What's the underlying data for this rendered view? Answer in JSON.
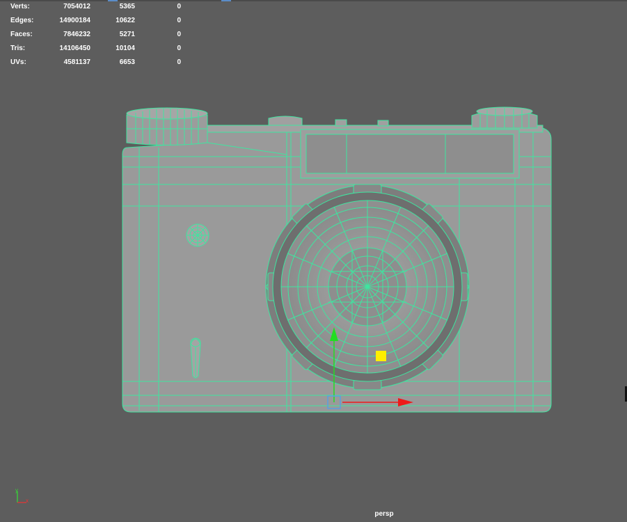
{
  "heads_up_display": {
    "rows": [
      {
        "label": "Verts:",
        "values": [
          "7054012",
          "5365",
          "0"
        ]
      },
      {
        "label": "Edges:",
        "values": [
          "14900184",
          "10622",
          "0"
        ]
      },
      {
        "label": "Faces:",
        "values": [
          "7846232",
          "5271",
          "0"
        ]
      },
      {
        "label": "Tris:",
        "values": [
          "14106450",
          "10104",
          "0"
        ]
      },
      {
        "label": "UVs:",
        "values": [
          "4581137",
          "6653",
          "0"
        ]
      }
    ]
  },
  "viewport": {
    "camera_name": "persp",
    "axis_indicator": {
      "y_label": "y",
      "x_label": "x"
    }
  },
  "colors": {
    "background": "#5d5d5d",
    "wireframe": "#3ee6a0",
    "model_surface": "#9a9a9a",
    "manipulator_x": "#ee1a1a",
    "manipulator_y": "#22dd22",
    "manipulator_center": "#5aa0e0",
    "pivot_marker": "#ffee00"
  },
  "icons": [
    "move-manipulator-icon",
    "axis-indicator-icon"
  ]
}
